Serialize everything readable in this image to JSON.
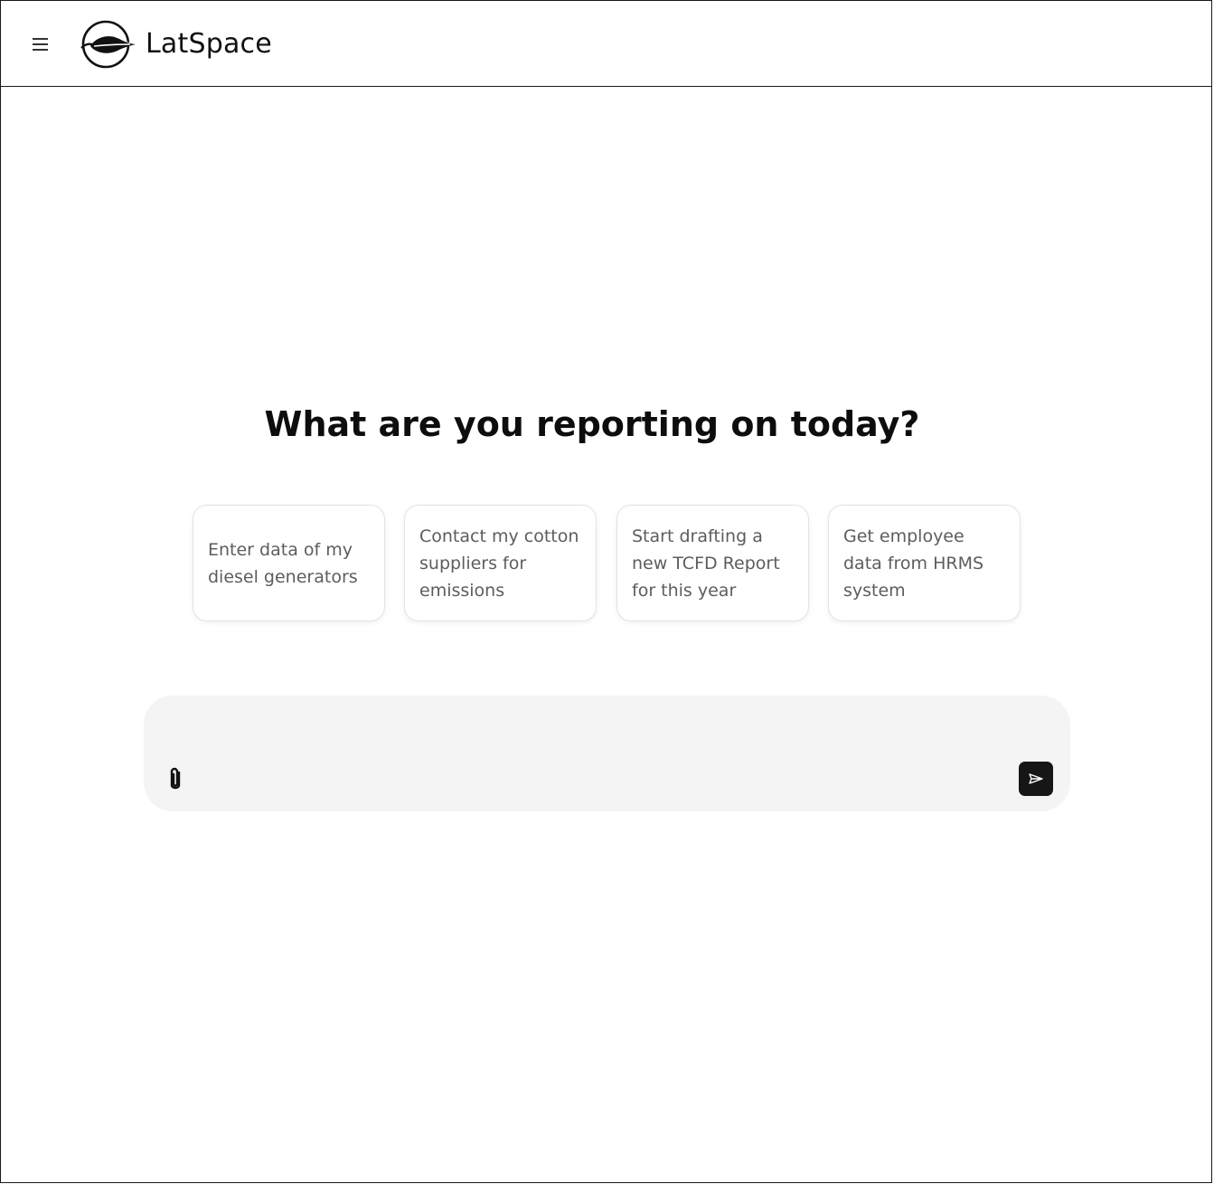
{
  "app": {
    "brand": "LatSpace",
    "icons": {
      "menu": "hamburger-icon",
      "logo": "leaf-logo-icon",
      "attach": "paperclip-icon",
      "send": "send-arrow-icon"
    }
  },
  "main": {
    "headline": "What are you reporting on today?",
    "suggestions": [
      "Enter data of my diesel generators",
      "Contact my cotton suppliers for emissions",
      "Start drafting a new TCFD Report for this year",
      "Get employee data from HRMS system"
    ]
  },
  "composer": {
    "value": "",
    "placeholder": ""
  },
  "colors": {
    "send_button": "#161616",
    "composer_bg": "#f4f4f4",
    "card_text": "#5d5d5d"
  }
}
